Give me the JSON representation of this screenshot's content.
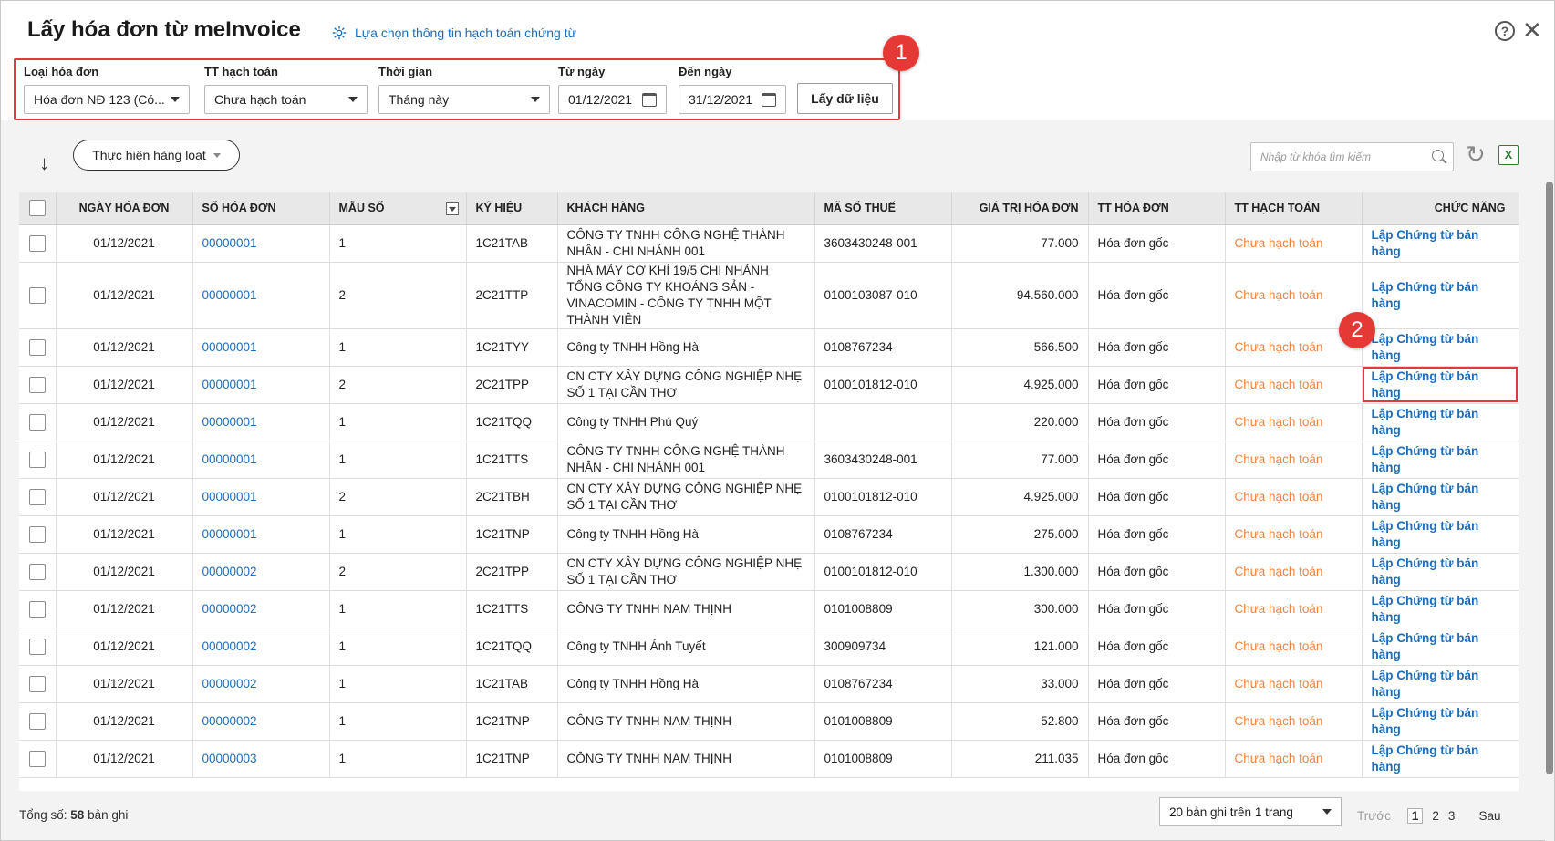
{
  "header": {
    "title": "Lấy hóa đơn từ meInvoice",
    "settings_link": "Lựa chọn thông tin hạch toán chứng từ"
  },
  "filters": {
    "invoice_type": {
      "label": "Loại hóa đơn",
      "value": "Hóa đơn NĐ 123 (Có..."
    },
    "accounting_status": {
      "label": "TT hạch toán",
      "value": "Chưa hạch toán"
    },
    "period": {
      "label": "Thời gian",
      "value": "Tháng này"
    },
    "from_date": {
      "label": "Từ ngày",
      "value": "01/12/2021"
    },
    "to_date": {
      "label": "Đến ngày",
      "value": "31/12/2021"
    },
    "fetch_button": "Lấy dữ liệu"
  },
  "annotations": {
    "badge1": "1",
    "badge2": "2"
  },
  "toolbar": {
    "bulk_button": "Thực hiện hàng loạt",
    "search_placeholder": "Nhập từ khóa tìm kiếm"
  },
  "table": {
    "headers": [
      "NGÀY HÓA ĐƠN",
      "SỐ HÓA ĐƠN",
      "MẪU SỐ",
      "KÝ HIỆU",
      "KHÁCH HÀNG",
      "MÃ SỐ THUẾ",
      "GIÁ TRỊ HÓA ĐƠN",
      "TT HÓA ĐƠN",
      "TT HẠCH TOÁN",
      "CHỨC NĂNG"
    ],
    "rows": [
      {
        "date": "01/12/2021",
        "number": "00000001",
        "form": "1",
        "symbol": "1C21TAB",
        "customer": "CÔNG TY TNHH CÔNG NGHỆ THÀNH NHÂN - CHI NHÁNH 001",
        "tax": "3603430248-001",
        "amount": "77.000",
        "inv_status": "Hóa đơn gốc",
        "acc_status": "Chưa hạch toán",
        "action": "Lập Chứng từ bán hàng"
      },
      {
        "date": "01/12/2021",
        "number": "00000001",
        "form": "2",
        "symbol": "2C21TTP",
        "customer": "NHÀ MÁY CƠ KHÍ 19/5 CHI NHÁNH TỔNG CÔNG TY KHOÁNG SẢN - VINACOMIN - CÔNG TY TNHH MỘT THÀNH VIÊN",
        "tax": "0100103087-010",
        "amount": "94.560.000",
        "inv_status": "Hóa đơn gốc",
        "acc_status": "Chưa hạch toán",
        "action": "Lập Chứng từ bán hàng"
      },
      {
        "date": "01/12/2021",
        "number": "00000001",
        "form": "1",
        "symbol": "1C21TYY",
        "customer": "Công ty TNHH Hồng Hà",
        "tax": "0108767234",
        "amount": "566.500",
        "inv_status": "Hóa đơn gốc",
        "acc_status": "Chưa hạch toán",
        "action": "Lập Chứng từ bán hàng"
      },
      {
        "date": "01/12/2021",
        "number": "00000001",
        "form": "2",
        "symbol": "2C21TPP",
        "customer": "CN CTY XÂY DỰNG CÔNG NGHIỆP NHẸ SỐ 1 TẠI CẦN THƠ",
        "tax": "0100101812-010",
        "amount": "4.925.000",
        "inv_status": "Hóa đơn gốc",
        "acc_status": "Chưa hạch toán",
        "action": "Lập Chứng từ bán hàng"
      },
      {
        "date": "01/12/2021",
        "number": "00000001",
        "form": "1",
        "symbol": "1C21TQQ",
        "customer": "Công ty TNHH Phú Quý",
        "tax": "",
        "amount": "220.000",
        "inv_status": "Hóa đơn gốc",
        "acc_status": "Chưa hạch toán",
        "action": "Lập Chứng từ bán hàng"
      },
      {
        "date": "01/12/2021",
        "number": "00000001",
        "form": "1",
        "symbol": "1C21TTS",
        "customer": "CÔNG TY TNHH CÔNG NGHỆ THÀNH NHÂN - CHI NHÁNH 001",
        "tax": "3603430248-001",
        "amount": "77.000",
        "inv_status": "Hóa đơn gốc",
        "acc_status": "Chưa hạch toán",
        "action": "Lập Chứng từ bán hàng"
      },
      {
        "date": "01/12/2021",
        "number": "00000001",
        "form": "2",
        "symbol": "2C21TBH",
        "customer": "CN CTY XÂY DỰNG CÔNG NGHIỆP NHẸ SỐ 1 TẠI CẦN THƠ",
        "tax": "0100101812-010",
        "amount": "4.925.000",
        "inv_status": "Hóa đơn gốc",
        "acc_status": "Chưa hạch toán",
        "action": "Lập Chứng từ bán hàng"
      },
      {
        "date": "01/12/2021",
        "number": "00000001",
        "form": "1",
        "symbol": "1C21TNP",
        "customer": "Công ty TNHH Hồng Hà",
        "tax": "0108767234",
        "amount": "275.000",
        "inv_status": "Hóa đơn gốc",
        "acc_status": "Chưa hạch toán",
        "action": "Lập Chứng từ bán hàng"
      },
      {
        "date": "01/12/2021",
        "number": "00000002",
        "form": "2",
        "symbol": "2C21TPP",
        "customer": "CN CTY XÂY DỰNG CÔNG NGHIỆP NHẸ SỐ 1 TẠI CẦN THƠ",
        "tax": "0100101812-010",
        "amount": "1.300.000",
        "inv_status": "Hóa đơn gốc",
        "acc_status": "Chưa hạch toán",
        "action": "Lập Chứng từ bán hàng"
      },
      {
        "date": "01/12/2021",
        "number": "00000002",
        "form": "1",
        "symbol": "1C21TTS",
        "customer": "CÔNG TY TNHH NAM THỊNH",
        "tax": "0101008809",
        "amount": "300.000",
        "inv_status": "Hóa đơn gốc",
        "acc_status": "Chưa hạch toán",
        "action": "Lập Chứng từ bán hàng"
      },
      {
        "date": "01/12/2021",
        "number": "00000002",
        "form": "1",
        "symbol": "1C21TQQ",
        "customer": "Công ty TNHH Ánh Tuyết",
        "tax": "300909734",
        "amount": "121.000",
        "inv_status": "Hóa đơn gốc",
        "acc_status": "Chưa hạch toán",
        "action": "Lập Chứng từ bán hàng"
      },
      {
        "date": "01/12/2021",
        "number": "00000002",
        "form": "1",
        "symbol": "1C21TAB",
        "customer": "Công ty TNHH Hồng Hà",
        "tax": "0108767234",
        "amount": "33.000",
        "inv_status": "Hóa đơn gốc",
        "acc_status": "Chưa hạch toán",
        "action": "Lập Chứng từ bán hàng"
      },
      {
        "date": "01/12/2021",
        "number": "00000002",
        "form": "1",
        "symbol": "1C21TNP",
        "customer": "CÔNG TY TNHH NAM THỊNH",
        "tax": "0101008809",
        "amount": "52.800",
        "inv_status": "Hóa đơn gốc",
        "acc_status": "Chưa hạch toán",
        "action": "Lập Chứng từ bán hàng"
      },
      {
        "date": "01/12/2021",
        "number": "00000003",
        "form": "1",
        "symbol": "1C21TNP",
        "customer": "CÔNG TY TNHH NAM THỊNH",
        "tax": "0101008809",
        "amount": "211.035",
        "inv_status": "Hóa đơn gốc",
        "acc_status": "Chưa hạch toán",
        "action": "Lập Chứng từ bán hàng"
      }
    ]
  },
  "footer": {
    "total_prefix": "Tổng số: ",
    "total_count": "58",
    "total_suffix": " bản ghi",
    "page_size": "20 bản ghi trên 1 trang",
    "prev": "Trước",
    "pages": [
      "1",
      "2",
      "3"
    ],
    "next": "Sau"
  },
  "colors": {
    "link": "#1c6dbd",
    "pending": "#f4823b",
    "highlight": "#e03a3a"
  }
}
